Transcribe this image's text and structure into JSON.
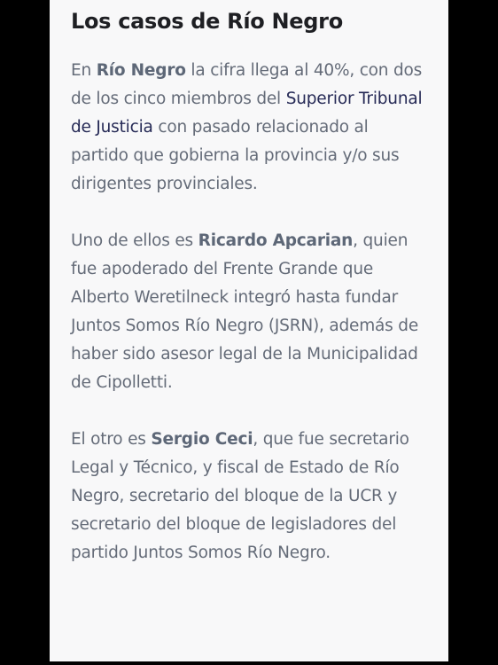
{
  "article": {
    "heading": "Los casos de Río Negro",
    "paragraphs": [
      {
        "parts": [
          {
            "t": "En "
          },
          {
            "t": "Río Negro",
            "bold": true
          },
          {
            "t": " la cifra llega al 40%, con dos de los cinco miembros del "
          },
          {
            "t": "Superior Tribunal de Justicia",
            "link": true
          },
          {
            "t": " con pasado relacionado al partido que gobierna la provincia y/o sus dirigentes provinciales."
          }
        ]
      },
      {
        "parts": [
          {
            "t": "Uno de ellos es "
          },
          {
            "t": "Ricardo Apcarian",
            "bold": true
          },
          {
            "t": ", quien fue apoderado del Frente Grande que Alberto Weretilneck integró hasta fundar Juntos Somos Río Negro (JSRN), además de haber sido asesor legal de la Municipalidad de Cipolletti."
          }
        ]
      },
      {
        "parts": [
          {
            "t": "El otro es "
          },
          {
            "t": "Sergio Ceci",
            "bold": true
          },
          {
            "t": ", que fue secretario Legal y Técnico, y fiscal de Estado de Río Negro, secretario del bloque de la UCR y secretario del bloque de legisladores del partido Juntos Somos Río Negro."
          }
        ]
      }
    ]
  },
  "colors": {
    "background": "#000000",
    "card": "#f8f8f9",
    "heading": "#1e1f23",
    "body_text": "#646b78",
    "link": "#262a56"
  }
}
